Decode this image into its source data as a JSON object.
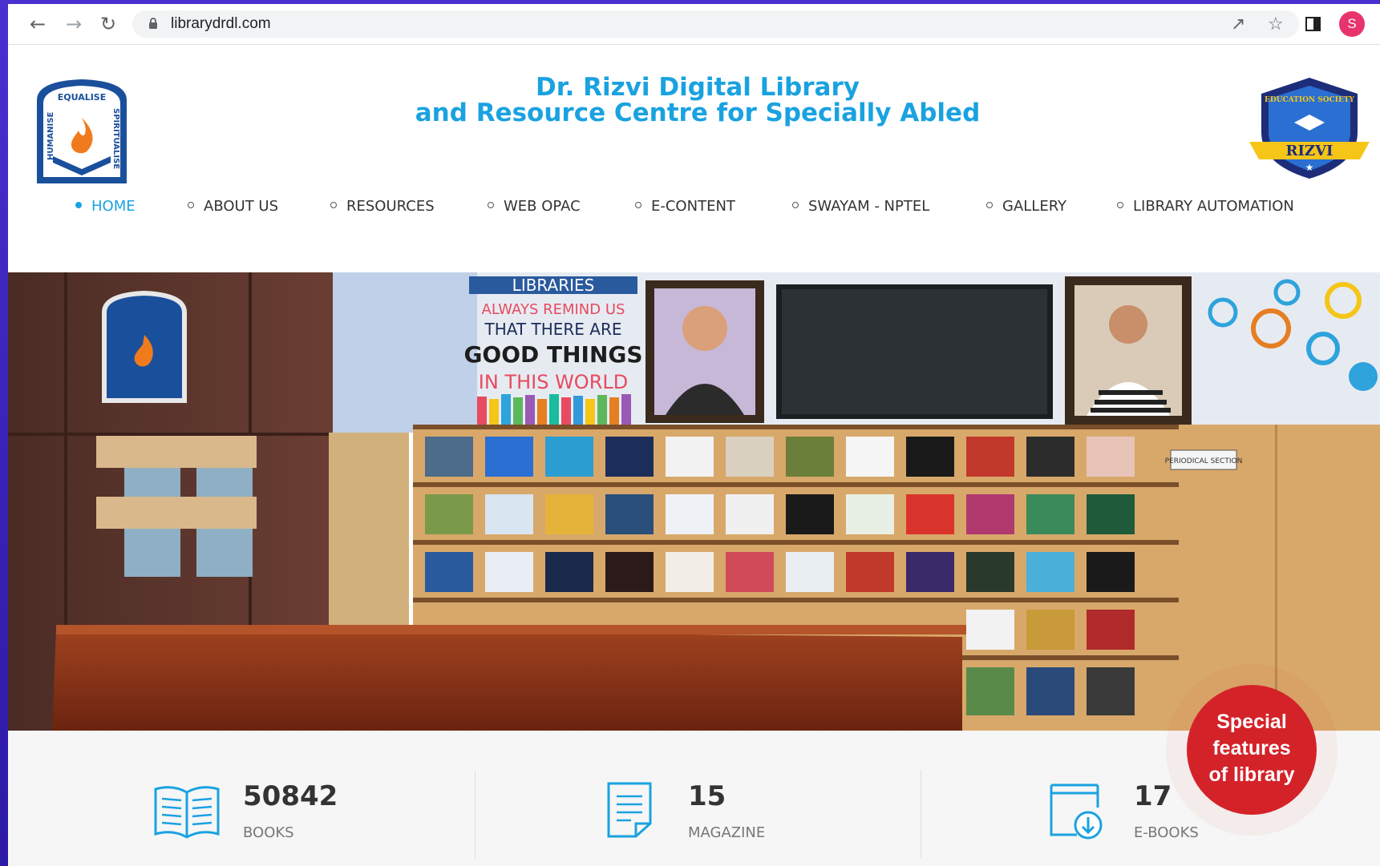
{
  "browser": {
    "url": "librarydrdl.com",
    "profile_initial": "S"
  },
  "header": {
    "title_line1": "Dr. Rizvi Digital Library",
    "title_line2": "and Resource Centre for Specially Abled"
  },
  "logos": {
    "left_text_top": "EQUALISE",
    "left_text_left": "HUMANISE",
    "left_text_right": "SPIRITUALISE",
    "right_text_top": "EDUCATION SOCIETY",
    "right_text_banner": "RIZVI"
  },
  "nav": {
    "items": [
      {
        "label": "HOME"
      },
      {
        "label": "ABOUT US"
      },
      {
        "label": "RESOURCES"
      },
      {
        "label": "WEB OPAC"
      },
      {
        "label": "E-CONTENT"
      },
      {
        "label": "SWAYAM - NPTEL"
      },
      {
        "label": "GALLERY"
      },
      {
        "label": "LIBRARY AUTOMATION"
      }
    ]
  },
  "hero": {
    "wall_banner": "LIBRARIES",
    "wall_quote_1": "ALWAYS REMIND US",
    "wall_quote_2": "THAT THERE ARE",
    "wall_quote_3": "GOOD THINGS",
    "wall_quote_4": "IN THIS WORLD",
    "periodical_sign": "PERIODICAL SECTION"
  },
  "stats": [
    {
      "value": "50842",
      "label": "BOOKS"
    },
    {
      "value": "15",
      "label": "MAGAZINE"
    },
    {
      "value": "17",
      "label": "E-BOOKS"
    }
  ],
  "special": {
    "line1": "Special",
    "line2": "features",
    "line3": "of library"
  },
  "colors": {
    "accent": "#1aa2e0",
    "special_red": "#d42229",
    "slide_bg": "#3a23b8"
  }
}
